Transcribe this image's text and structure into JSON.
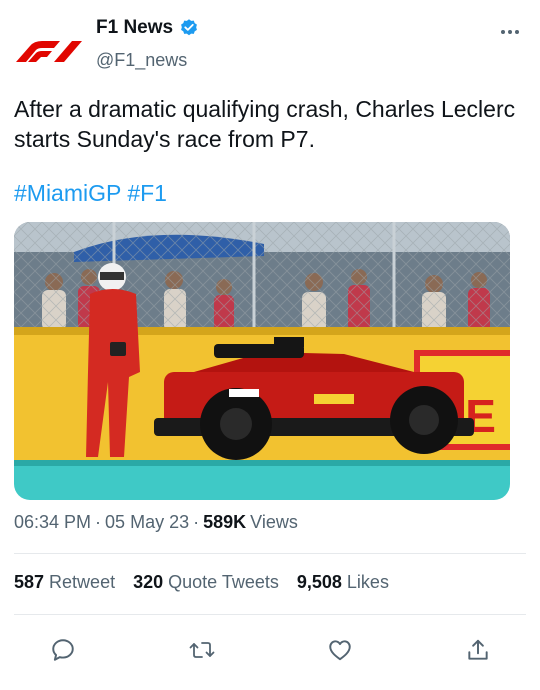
{
  "author": {
    "display_name": "F1 News",
    "handle": "@F1_news",
    "avatar_icon": "f1-logo-icon",
    "verified_icon": "verified-badge-icon",
    "brand_color": "#e10600",
    "verified_color": "#1d9bf0"
  },
  "more_icon": "more-options-icon",
  "tweet": {
    "text": "After a dramatic qualifying crash, Charles Leclerc starts Sunday's race from P7.",
    "hashtags": [
      "#MiamiGP",
      "#F1"
    ]
  },
  "media": {
    "alt": "Charles Leclerc walking away from his crashed red Ferrari next to a Pirelli barrier"
  },
  "meta": {
    "time": "06:34 PM",
    "separator": "·",
    "date": "05 May 23",
    "views_count": "589K",
    "views_label": "Views"
  },
  "stats": {
    "retweets_count": "587",
    "retweets_label": "Retweet",
    "quotes_count": "320",
    "quotes_label": "Quote Tweets",
    "likes_count": "9,508",
    "likes_label": "Likes"
  },
  "actions": [
    {
      "icon": "reply-icon"
    },
    {
      "icon": "retweet-icon"
    },
    {
      "icon": "like-icon"
    },
    {
      "icon": "share-icon"
    }
  ],
  "colors": {
    "text_primary": "#0f1419",
    "text_secondary": "#536471",
    "link": "#1d9bf0",
    "divider": "#e6e9ec"
  }
}
